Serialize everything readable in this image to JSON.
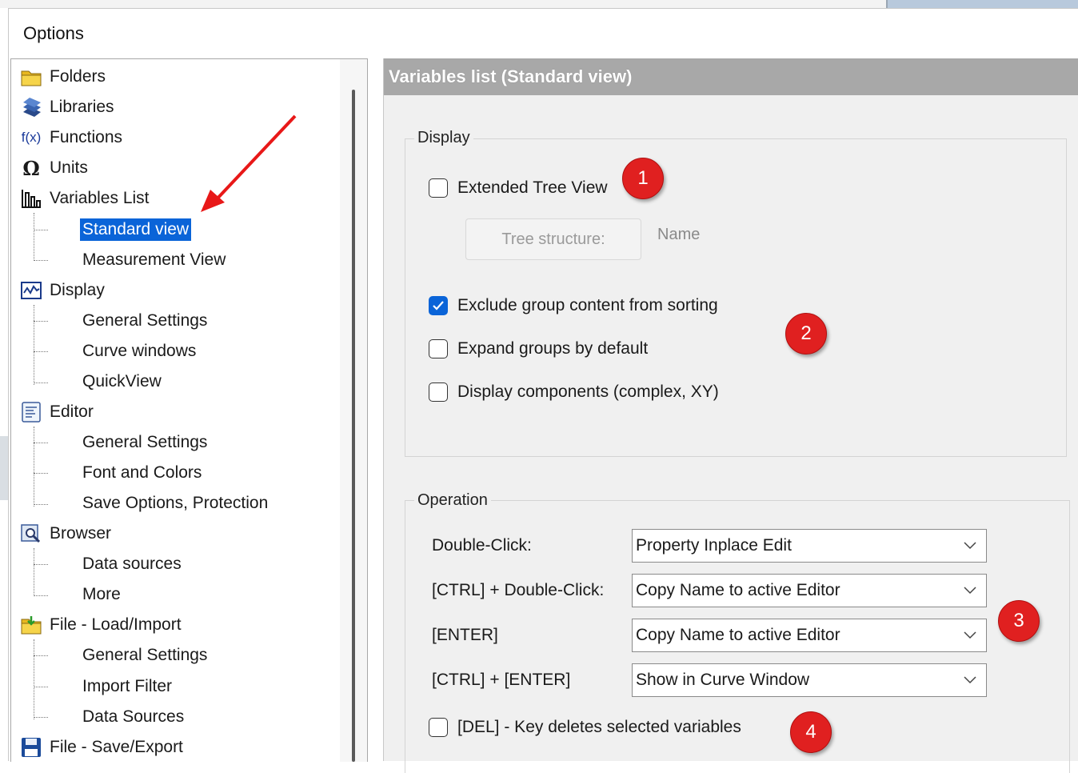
{
  "dialog": {
    "title": "Options"
  },
  "tree": {
    "items": [
      {
        "label": "Folders",
        "icon": "folder-icon"
      },
      {
        "label": "Libraries",
        "icon": "books-icon"
      },
      {
        "label": "Functions",
        "icon": "function-fx-icon"
      },
      {
        "label": "Units",
        "icon": "omega-icon"
      },
      {
        "label": "Variables List",
        "icon": "variables-list-icon",
        "children": [
          "Standard view",
          "Measurement View"
        ]
      },
      {
        "label": "Display",
        "icon": "display-chart-icon",
        "children": [
          "General Settings",
          "Curve windows",
          "QuickView"
        ]
      },
      {
        "label": "Editor",
        "icon": "editor-document-icon",
        "children": [
          "General Settings",
          "Font and Colors",
          "Save Options, Protection"
        ]
      },
      {
        "label": "Browser",
        "icon": "browser-search-icon",
        "children": [
          "Data sources",
          "More"
        ]
      },
      {
        "label": "File - Load/Import",
        "icon": "folder-load-icon",
        "children": [
          "General Settings",
          "Import Filter",
          "Data Sources"
        ]
      },
      {
        "label": "File - Save/Export",
        "icon": "floppy-save-icon"
      }
    ],
    "selected": "Standard view"
  },
  "panel": {
    "title": "Variables list (Standard view)",
    "display_group": {
      "label": "Display",
      "extended_tree_view": {
        "label": "Extended Tree View",
        "checked": false
      },
      "tree_structure_button": "Tree structure:",
      "tree_structure_value": "Name",
      "exclude_group_content": {
        "label": "Exclude group content from sorting",
        "checked": true
      },
      "expand_groups": {
        "label": "Expand groups by default",
        "checked": false
      },
      "display_components": {
        "label": "Display components (complex, XY)",
        "checked": false
      }
    },
    "operation_group": {
      "label": "Operation",
      "rows": [
        {
          "label": "Double-Click:",
          "value": "Property Inplace Edit"
        },
        {
          "label": "[CTRL] + Double-Click:",
          "value": "Copy Name to active Editor"
        },
        {
          "label": "[ENTER]",
          "value": "Copy Name to active Editor"
        },
        {
          "label": "[CTRL] + [ENTER]",
          "value": "Show in Curve Window"
        }
      ],
      "del_key": {
        "label": "[DEL] - Key deletes selected variables",
        "checked": false
      }
    }
  },
  "annotations": {
    "badges": [
      "1",
      "2",
      "3",
      "4"
    ],
    "color": "#e02020"
  },
  "colors": {
    "selection": "#0a64d8",
    "header": "#a8a8a8",
    "panel_bg": "#f0f0f0"
  }
}
